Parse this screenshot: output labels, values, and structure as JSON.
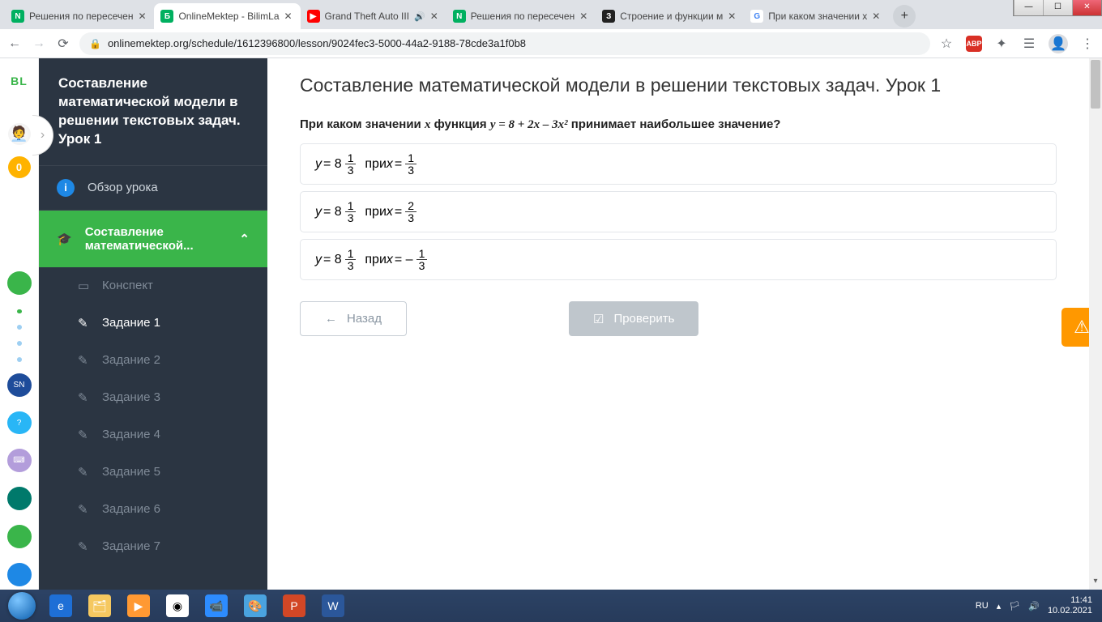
{
  "window_buttons": {
    "min": "—",
    "max": "☐",
    "close": "✕"
  },
  "tabs": [
    {
      "favicon_bg": "#00b060",
      "favicon_text": "N",
      "title": "Решения по пересечен",
      "active": false,
      "audio": false
    },
    {
      "favicon_bg": "#00b060",
      "favicon_text": "Б",
      "title": "OnlineMektep - BilimLa",
      "active": true,
      "audio": false
    },
    {
      "favicon_bg": "#ff0000",
      "favicon_text": "▶",
      "title": "Grand Theft Auto III",
      "active": false,
      "audio": true
    },
    {
      "favicon_bg": "#00b060",
      "favicon_text": "N",
      "title": "Решения по пересечен",
      "active": false,
      "audio": false
    },
    {
      "favicon_bg": "#222222",
      "favicon_text": "З",
      "title": "Строение и функции м",
      "active": false,
      "audio": false
    },
    {
      "favicon_bg": "#ffffff",
      "favicon_text": "G",
      "title": "При каком значении x",
      "active": false,
      "audio": false
    }
  ],
  "addr": {
    "url": "onlinemektep.org/schedule/1612396800/lesson/9024fec3-5000-44a2-9188-78cde3a1f0b8",
    "abp": "ABP"
  },
  "rail": {
    "logo": "BL",
    "score": "0"
  },
  "sidebar": {
    "lesson_title": "Составление математической модели в решении текстовых задач. Урок 1",
    "overview_label": "Обзор урока",
    "section_label": "Составление математической...",
    "items": [
      {
        "icon": "book",
        "label": "Конспект",
        "active": false
      },
      {
        "icon": "edit",
        "label": "Задание 1",
        "active": true
      },
      {
        "icon": "edit",
        "label": "Задание 2",
        "active": false
      },
      {
        "icon": "edit",
        "label": "Задание 3",
        "active": false
      },
      {
        "icon": "edit",
        "label": "Задание 4",
        "active": false
      },
      {
        "icon": "edit",
        "label": "Задание 5",
        "active": false
      },
      {
        "icon": "edit",
        "label": "Задание 6",
        "active": false
      },
      {
        "icon": "edit",
        "label": "Задание 7",
        "active": false
      }
    ]
  },
  "main": {
    "heading": "Составление математической модели в решении текстовых задач. Урок 1",
    "question_pre": "При каком значении ",
    "question_var": "x",
    "question_mid": " функция ",
    "question_func": "y = 8 + 2x – 3x²",
    "question_post": " принимает наибольшее значение?",
    "answers": [
      {
        "y_int": "8",
        "y_n": "1",
        "y_d": "3",
        "at": " при ",
        "x_sign": "",
        "x_n": "1",
        "x_d": "3"
      },
      {
        "y_int": "8",
        "y_n": "1",
        "y_d": "3",
        "at": " при ",
        "x_sign": "",
        "x_n": "2",
        "x_d": "3"
      },
      {
        "y_int": "8",
        "y_n": "1",
        "y_d": "3",
        "at": " при ",
        "x_sign": "– ",
        "x_n": "1",
        "x_d": "3"
      }
    ],
    "back_label": "Назад",
    "check_label": "Проверить"
  },
  "taskbar": {
    "lang": "RU",
    "time": "11:41",
    "date": "10.02.2021"
  }
}
